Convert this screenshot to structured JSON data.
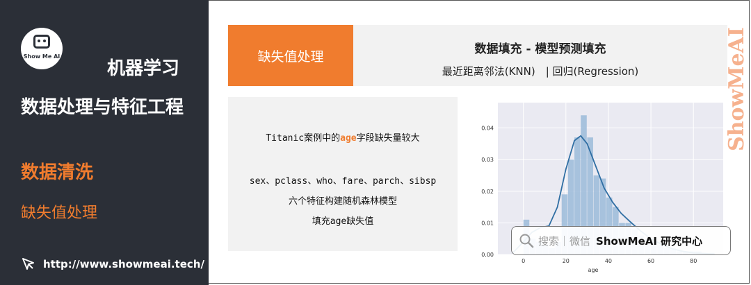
{
  "sidebar": {
    "logo_text": "Show Me AI",
    "title1": "机器学习",
    "title2": "数据处理与特征工程",
    "section": "数据清洗",
    "subsection": "缺失值处理",
    "link": "http://www.showmeai.tech/"
  },
  "header": {
    "tag": "缺失值处理",
    "title": "数据填充 - 模型预测填充",
    "subtitle": "最近距离邻法(KNN)　| 回归(Regression)"
  },
  "text_box": {
    "line1_prefix": "Titanic案例中的",
    "line1_highlight": "age",
    "line1_suffix": "字段缺失量较大",
    "line2": "sex、pclass、who、fare、parch、sibsp",
    "line3": "六个特征构建随机森林模型",
    "line4": "填充age缺失值"
  },
  "search_badge": {
    "label": "搜索｜微信",
    "brand": "ShowMeAI 研究中心"
  },
  "watermark_text": "ShowMeAI",
  "colors": {
    "accent": "#f07c2e",
    "sidebar_bg": "#2b2f37",
    "hist": "#9bbbd9",
    "kde": "#2f6ea3"
  },
  "chart_data": {
    "type": "bar",
    "xlabel": "age",
    "ylabel": "",
    "xlim": [
      -12,
      94
    ],
    "ylim": [
      0,
      0.048
    ],
    "xticks": [
      0,
      20,
      40,
      60,
      80
    ],
    "yticks": [
      0.0,
      0.01,
      0.02,
      0.03,
      0.04
    ],
    "ytick_labels": [
      "0.00",
      "0.01",
      "0.02",
      "0.03",
      "0.04"
    ],
    "bin_edges": [
      0,
      3,
      6,
      9,
      12,
      15,
      18,
      21,
      24,
      27,
      30,
      33,
      36,
      39,
      42,
      45,
      48,
      51,
      54,
      57,
      60,
      63,
      66,
      69,
      72,
      75,
      78,
      81,
      84,
      87,
      90
    ],
    "values": [
      0.011,
      0.005,
      0.004,
      0.003,
      0.002,
      0.004,
      0.019,
      0.03,
      0.037,
      0.044,
      0.037,
      0.025,
      0.024,
      0.018,
      0.015,
      0.01,
      0.01,
      0.008,
      0.006,
      0.005,
      0.004,
      0.003,
      0.002,
      0.002,
      0.001,
      0.001,
      0.001,
      0.001,
      0.0005,
      0.0005
    ],
    "kde": {
      "x": [
        -5,
        0,
        4,
        8,
        12,
        16,
        20,
        24,
        27,
        30,
        34,
        38,
        42,
        46,
        50,
        55,
        60,
        65,
        70,
        75,
        80,
        85,
        90
      ],
      "y": [
        0.0005,
        0.004,
        0.007,
        0.0085,
        0.009,
        0.015,
        0.027,
        0.036,
        0.0375,
        0.035,
        0.028,
        0.021,
        0.0165,
        0.013,
        0.0105,
        0.0075,
        0.005,
        0.0032,
        0.0018,
        0.001,
        0.0005,
        0.0003,
        0.0001
      ]
    },
    "grid": true
  }
}
